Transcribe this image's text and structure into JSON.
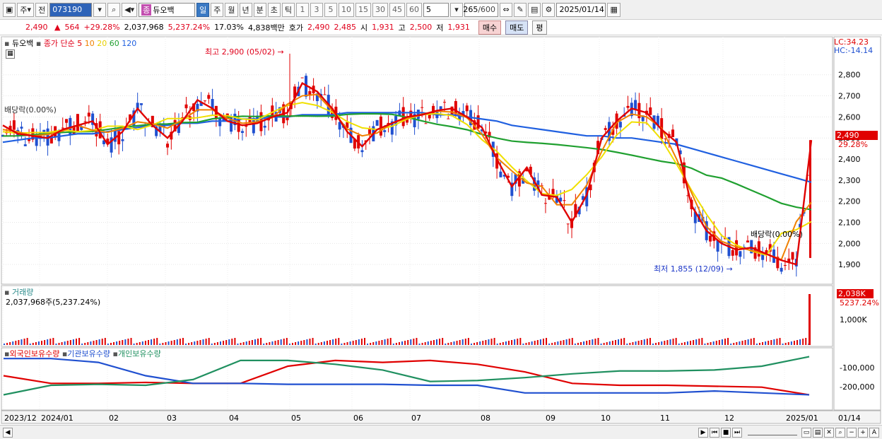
{
  "toolbar": {
    "period_select": "주",
    "prev_label": "전",
    "stock_code": "073190",
    "stock_name": "듀오백",
    "stock_badge": "종",
    "period_tabs": [
      "일",
      "주",
      "월",
      "년",
      "분",
      "초",
      "틱"
    ],
    "active_period": "일",
    "intervals": [
      "1",
      "3",
      "5",
      "10",
      "15",
      "30",
      "45",
      "60"
    ],
    "interval_value": "5",
    "view_count": "265",
    "view_total": "/600",
    "date": "2025/01/14"
  },
  "quote": {
    "price": "2,490",
    "change": "564",
    "change_rate": "+29.28%",
    "volume": "2,037,968",
    "volume_rate": "5,237.24%",
    "turnover": "17.03%",
    "amount": "4,838백만",
    "bid_label": "호가",
    "ask": "2,490",
    "bid": "2,485",
    "open_label": "시",
    "open": "1,931",
    "high_label": "고",
    "high": "2,500",
    "low_label": "저",
    "low": "1,931",
    "buy_label": "매수",
    "sell_label": "매도",
    "eval_label": "평"
  },
  "legend": {
    "stock": "듀오백",
    "ma_title": "종가 단순",
    "ma": [
      "5",
      "10",
      "20",
      "60",
      "120"
    ],
    "ma_colors": [
      "#e00000",
      "#f08000",
      "#f0e000",
      "#20a030",
      "#2060e0"
    ]
  },
  "price_labels": {
    "lc": "LC:34.23",
    "hc": "HC:-14.14",
    "last": "2,490",
    "last_rate": "29.28%",
    "high_note": "최고 2,900 (05/02)",
    "low_note": "최저 1,855 (12/09)",
    "div_note": "배당락(0.00%)",
    "div_note_left": "배당락(0.00%)"
  },
  "volume_panel": {
    "title": "거래량",
    "value": "2,037,968주(5,237.24%)",
    "last": "2,038K",
    "last_rate": "5237.24%",
    "tick": "1,000K"
  },
  "holding_panel": {
    "legend": [
      "외국인보유수량",
      "기관보유수량",
      "개인보유수량"
    ],
    "colors": [
      "#e00000",
      "#2050d0",
      "#209060"
    ],
    "ticks": [
      "-100,000",
      "-200,000"
    ]
  },
  "x_axis": {
    "labels": [
      "2023/12",
      "2024/01",
      "02",
      "03",
      "04",
      "05",
      "06",
      "07",
      "08",
      "09",
      "10",
      "11",
      "12",
      "2025/01"
    ],
    "right": "01/14"
  },
  "chart_data": {
    "type": "line",
    "y_ticks": [
      2800,
      2700,
      2600,
      2500,
      2400,
      2300,
      2200,
      2100,
      2000,
      1900
    ],
    "ylim": [
      1820,
      2960
    ],
    "last_price": 2490,
    "high_price": 2900,
    "low_price": 1855,
    "ma5": [
      2560,
      2520,
      2510,
      2500,
      2540,
      2560,
      2580,
      2470,
      2530,
      2640,
      2560,
      2500,
      2580,
      2680,
      2640,
      2580,
      2560,
      2570,
      2600,
      2620,
      2760,
      2720,
      2640,
      2530,
      2460,
      2540,
      2570,
      2600,
      2610,
      2630,
      2640,
      2600,
      2550,
      2400,
      2270,
      2360,
      2230,
      2220,
      2100,
      2230,
      2500,
      2580,
      2640,
      2620,
      2540,
      2480,
      2180,
      2060,
      2000,
      1970,
      1980,
      1950,
      1920,
      1900,
      2490
    ],
    "ma120": [
      2480,
      2490,
      2500,
      2500,
      2510,
      2520,
      2520,
      2530,
      2540,
      2550,
      2560,
      2560,
      2570,
      2570,
      2580,
      2580,
      2590,
      2590,
      2600,
      2600,
      2610,
      2610,
      2610,
      2620,
      2620,
      2620,
      2620,
      2620,
      2620,
      2610,
      2610,
      2600,
      2590,
      2580,
      2560,
      2550,
      2540,
      2530,
      2520,
      2510,
      2510,
      2500,
      2500,
      2490,
      2480,
      2470,
      2450,
      2430,
      2410,
      2390,
      2370,
      2350,
      2330,
      2310,
      2290
    ]
  }
}
